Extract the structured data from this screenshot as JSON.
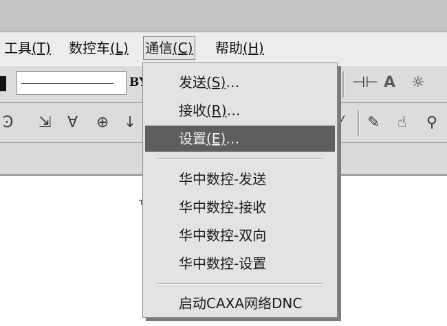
{
  "menubar": {
    "items": [
      {
        "label": "工具",
        "mnemonic": "(T)"
      },
      {
        "label": "数控车",
        "mnemonic": "(L)"
      },
      {
        "label": "通信",
        "mnemonic": "(C)"
      },
      {
        "label": "帮助",
        "mnemonic": "(H)"
      }
    ]
  },
  "toolbar": {
    "bylayer_label": "BY"
  },
  "dropdown": {
    "items": [
      {
        "label": "发送",
        "mnemonic": "(S)",
        "suffix": "…"
      },
      {
        "label": "接收",
        "mnemonic": "(R)",
        "suffix": "…"
      },
      {
        "label": "设置",
        "mnemonic": "(E)",
        "suffix": "…"
      },
      {
        "label": "华中数控-发送"
      },
      {
        "label": "华中数控-接收"
      },
      {
        "label": "华中数控-双向"
      },
      {
        "label": "华中数控-设置"
      },
      {
        "label": "启动CAXA网络DNC"
      }
    ],
    "selected_index": 2
  },
  "icons": {
    "toolbar_row1": [
      "dimension-icon",
      "text-a-icon",
      "text-style-icon"
    ],
    "toolbar_row2": [
      "curve-tool-icon",
      "point-b-icon",
      "vertex-icon",
      "globe-icon",
      "arrow-down-icon",
      "slash-icon",
      "pen-icon",
      "hand-pointer-icon",
      "zoom-icon"
    ]
  }
}
